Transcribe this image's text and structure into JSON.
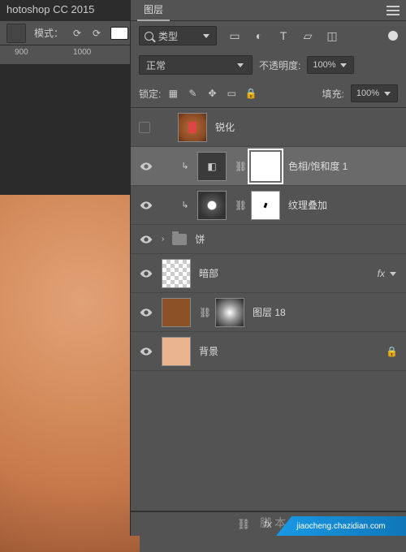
{
  "app_title": "hotoshop CC 2015",
  "options_bar": {
    "mode_label": "模式："
  },
  "ruler": {
    "t900": "900",
    "t1000": "1000"
  },
  "panel": {
    "tab_label": "图层",
    "filter": {
      "label": "类型"
    },
    "filter_icons": {
      "image": "▭",
      "adj": "◐",
      "text": "T",
      "shape": "▱",
      "smart": "◫"
    },
    "blend": {
      "mode": "正常",
      "opacity_label": "不透明度:",
      "opacity_value": "100%"
    },
    "locks": {
      "label": "锁定:",
      "fill_label": "填充:",
      "fill_value": "100%"
    }
  },
  "layers": {
    "l0": {
      "name": "锐化"
    },
    "l1": {
      "name": "色相/饱和度 1"
    },
    "l2": {
      "name": "纹理叠加"
    },
    "l3": {
      "name": "饼"
    },
    "l4": {
      "name": "暗部",
      "fx": "fx"
    },
    "l5": {
      "name": "图层 18"
    },
    "l6": {
      "name": "背景"
    }
  },
  "watermark": {
    "domain": "jiaocheng.chazidian.com",
    "text": "脚本 之家"
  }
}
